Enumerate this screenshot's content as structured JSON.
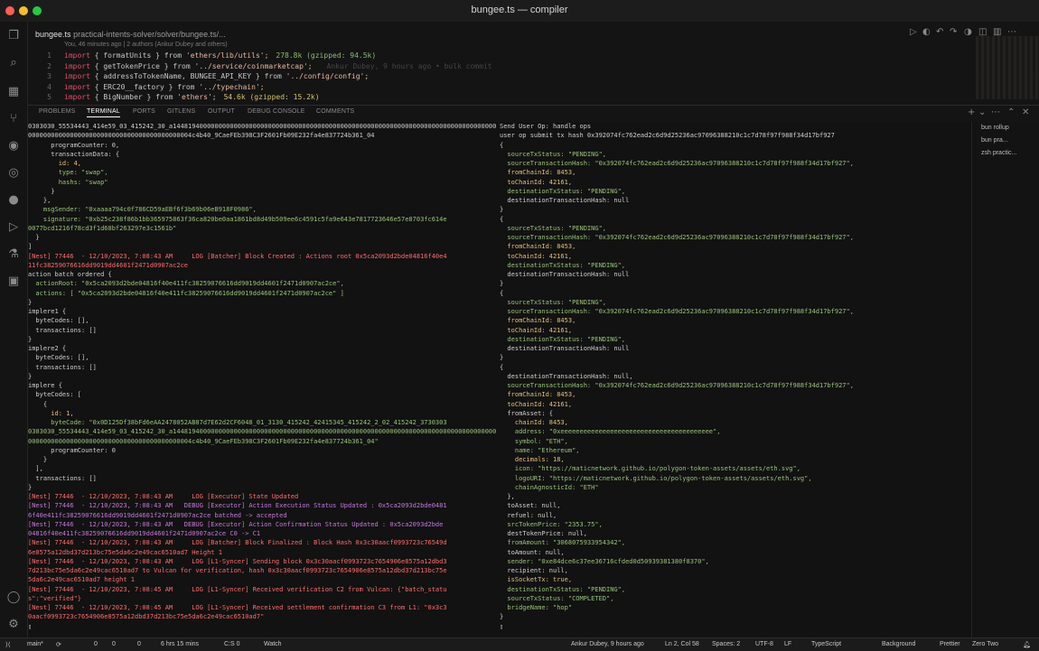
{
  "window": {
    "title": "bungee.ts — compiler",
    "dot_colors": [
      "#ff5f57",
      "#febc2e",
      "#28c840"
    ]
  },
  "editor": {
    "tab_name": "bungee.ts",
    "breadcrumb": "practical-intents-solver/solver/bungee.ts/...",
    "blame": "You, 46 minutes ago | 2 authors (Ankur Dubey and others)",
    "lines": [
      {
        "num": "1",
        "kw": "import",
        "body": " { formatUnits } from ",
        "src": "'ethers/lib/utils';",
        "size": "278.8k (gzipped: 94.5k)",
        "ghost": ""
      },
      {
        "num": "2",
        "kw": "import",
        "body": " { getTokenPrice } from ",
        "src": "'../service/coinmarketcap';",
        "size": "",
        "ghost": "Ankur Dubey, 9 hours ago • bulk commit"
      },
      {
        "num": "3",
        "kw": "import",
        "body": " { addressToTokenName, BUNGEE_API_KEY } from ",
        "src": "'../config/config';",
        "size": "",
        "ghost": ""
      },
      {
        "num": "4",
        "kw": "import",
        "body": " { ERC20__factory } from ",
        "src": "'../typechain';",
        "size": "",
        "ghost": ""
      },
      {
        "num": "5",
        "kw": "import",
        "body": " { BigNumber } from ",
        "src": "'ethers';",
        "size2": "54.6k (gzipped: 15.2k)",
        "ghost": ""
      }
    ]
  },
  "panel": {
    "tabs": [
      "PROBLEMS",
      "TERMINAL",
      "PORTS",
      "GITLENS",
      "OUTPUT",
      "DEBUG CONSOLE",
      "COMMENTS"
    ],
    "active_tab": "TERMINAL",
    "sessions": [
      "bun rollup",
      "bun pra...",
      "zsh practic..."
    ]
  },
  "terminal_left": [
    {
      "t": "0303030_55534443_414e59_03_415242_30_a1448194000000000000000000000000000000000000000000000000000000000000000000000000000000",
      "c": "g"
    },
    {
      "t": "0000000000000000000000000000000000000000004c4b40_9CaeFEb398C3F2601Fb09E232fa4e837724b361_04",
      "c": "g"
    },
    {
      "t": "      programCounter: 0,",
      "c": "g"
    },
    {
      "t": "      transactionData: {",
      "c": "g"
    },
    {
      "t": "        id: 4,",
      "c": "n"
    },
    {
      "t": "        type: \"swap\",",
      "c": "s"
    },
    {
      "t": "        hashs: \"swap\"",
      "c": "s"
    },
    {
      "t": "      }",
      "c": "g"
    },
    {
      "t": "    },",
      "c": "g"
    },
    {
      "t": "    msgSender: \"0xaaaa794c0f786CD59aEBf6f3b69b06eB918F0986\",",
      "c": "s"
    },
    {
      "t": "    signature: \"0xb25c238f86b1bb365975863f36ca820be0aa1861bd8d49b509ee6c4591c5fa9e643e7817723646e57e8703fc614e",
      "c": "s"
    },
    {
      "t": "0077bcd1216f78cd3f1d68bf263297e3c1561b\"",
      "c": "s"
    },
    {
      "t": "  }",
      "c": "g"
    },
    {
      "t": "]",
      "c": "g"
    },
    {
      "t": "[Nest] 77446  - 12/10/2023, 7:08:43 AM     LOG [Batcher] Block Created : Actions root 0x5ca2093d2bde04816f40e4",
      "c": "r"
    },
    {
      "t": "11fc38259076616dd9019dd4601f2471d0907ac2ce",
      "c": "r"
    },
    {
      "t": "action batch ordered {",
      "c": "g"
    },
    {
      "t": "  actionRoot: \"0x5ca2093d2bde04816f40e411fc38259076616dd9019dd4601f2471d0907ac2ce\",",
      "c": "s"
    },
    {
      "t": "  actions: [ \"0x5ca2093d2bde04816f40e411fc38259076616dd9019dd4601f2471d0907ac2ce\" ]",
      "c": "s"
    },
    {
      "t": "}",
      "c": "g"
    },
    {
      "t": "implere1 {",
      "c": "g"
    },
    {
      "t": "  byteCodes: [],",
      "c": "g"
    },
    {
      "t": "  transactions: []",
      "c": "g"
    },
    {
      "t": "}",
      "c": "g"
    },
    {
      "t": "implere2 {",
      "c": "g"
    },
    {
      "t": "  byteCodes: [],",
      "c": "g"
    },
    {
      "t": "  transactions: []",
      "c": "g"
    },
    {
      "t": "}",
      "c": "g"
    },
    {
      "t": "implere {",
      "c": "g"
    },
    {
      "t": "  byteCodes: [",
      "c": "g"
    },
    {
      "t": "    {",
      "c": "g"
    },
    {
      "t": "      id: 1,",
      "c": "n"
    },
    {
      "t": "      byteCode: \"0x0D125Df38bFd6eAA2478052AB87d7E62d2CF6048_01_3130_415242_42415345_415242_2_02_415242_3730303",
      "c": "s"
    },
    {
      "t": "0303030_55534443_414e59_03_415242_30_a1448194000000000000000000000000000000000000000000000000000000000000000000000000000000",
      "c": "s"
    },
    {
      "t": "0000000000000000000000000000000000000000004c4b40_9CaeFEb398C3F2601Fb09E232fa4e837724b361_04\"",
      "c": "s"
    },
    {
      "t": "      programCounter: 0",
      "c": "g"
    },
    {
      "t": "    }",
      "c": "g"
    },
    {
      "t": "  ],",
      "c": "g"
    },
    {
      "t": "  transactions: []",
      "c": "g"
    },
    {
      "t": "}",
      "c": "g"
    },
    {
      "t": "[Nest] 77446  - 12/10/2023, 7:08:43 AM     LOG [Executor] State Updated",
      "c": "r"
    },
    {
      "t": "[Nest] 77446  - 12/10/2023, 7:08:43 AM   DEBUG [Executor] Action Execution Status Updated : 0x5ca2093d2bde0481",
      "c": "v"
    },
    {
      "t": "6f40e411fc38259076616dd9019dd4601f2471d0907ac2ce batched -> accepted",
      "c": "v"
    },
    {
      "t": "[Nest] 77446  - 12/10/2023, 7:08:43 AM   DEBUG [Executor] Action Confirmation Status Updated : 0x5ca2093d2bde",
      "c": "v"
    },
    {
      "t": "04816f40e411fc38259076616dd9019dd4601f2471d0907ac2ce C0 -> C1",
      "c": "v"
    },
    {
      "t": "[Nest] 77446  - 12/10/2023, 7:08:43 AM     LOG [Batcher] Block Finalized : Block Hash 0x3c30aacf0993723c76549d",
      "c": "r"
    },
    {
      "t": "6e8575a12dbd37d213bc75e5da6c2e49cac6510ad7 Height 1",
      "c": "r"
    },
    {
      "t": "[Nest] 77446  - 12/10/2023, 7:08:43 AM     LOG [L1-Syncer] Sending block 0x3c30aacf0993723c7654906e8575a12dbd3",
      "c": "r"
    },
    {
      "t": "7d213bc75e5da6c2e49cac6510ad7 to Vulcan for verification, hash 0x3c30aacf0993723c7654906e8575a12dbd37d213bc75e",
      "c": "r"
    },
    {
      "t": "5da6c2e49cac6510ad7 height 1",
      "c": "r"
    },
    {
      "t": "[Nest] 77446  - 12/10/2023, 7:08:45 AM     LOG [L1-Syncer] Received verification C2 from Vulcan: {\"batch_statu",
      "c": "r"
    },
    {
      "t": "s\":\"verified\"}",
      "c": "r"
    },
    {
      "t": "[Nest] 77446  - 12/10/2023, 7:08:45 AM     LOG [L1-Syncer] Received settlement confirmation C3 from L1: \"0x3c3",
      "c": "r"
    },
    {
      "t": "0aacf0993723c7654906e8575a12dbd37d213bc75e5da6c2e49cac6510ad7\"",
      "c": "r"
    },
    {
      "t": "▯",
      "c": "g"
    }
  ],
  "terminal_right": [
    {
      "t": "Send User Op: handle ops",
      "c": "g"
    },
    {
      "t": "user op submit tx hash 0x392074fc762ead2c6d9d25236ac97096388210c1c7d78f97f988f34d17bf927",
      "c": "g"
    },
    {
      "t": "{",
      "c": "g"
    },
    {
      "t": "  sourceTxStatus: \"PENDING\",",
      "c": "s"
    },
    {
      "t": "  sourceTransactionHash: \"0x392074fc762ead2c6d9d25236ac97096388210c1c7d78f97f988f34d17bf927\",",
      "c": "s"
    },
    {
      "t": "  fromChainId: 8453,",
      "c": "n"
    },
    {
      "t": "  toChainId: 42161,",
      "c": "n"
    },
    {
      "t": "  destinationTxStatus: \"PENDING\",",
      "c": "s"
    },
    {
      "t": "  destinationTransactionHash: null",
      "c": "g"
    },
    {
      "t": "}",
      "c": "g"
    },
    {
      "t": "{",
      "c": "g"
    },
    {
      "t": "  sourceTxStatus: \"PENDING\",",
      "c": "s"
    },
    {
      "t": "  sourceTransactionHash: \"0x392074fc762ead2c6d9d25236ac97096388210c1c7d78f97f988f34d17bf927\",",
      "c": "s"
    },
    {
      "t": "  fromChainId: 8453,",
      "c": "n"
    },
    {
      "t": "  toChainId: 42161,",
      "c": "n"
    },
    {
      "t": "  destinationTxStatus: \"PENDING\",",
      "c": "s"
    },
    {
      "t": "  destinationTransactionHash: null",
      "c": "g"
    },
    {
      "t": "}",
      "c": "g"
    },
    {
      "t": "{",
      "c": "g"
    },
    {
      "t": "  sourceTxStatus: \"PENDING\",",
      "c": "s"
    },
    {
      "t": "  sourceTransactionHash: \"0x392074fc762ead2c6d9d25236ac97096388210c1c7d78f97f988f34d17bf927\",",
      "c": "s"
    },
    {
      "t": "  fromChainId: 8453,",
      "c": "n"
    },
    {
      "t": "  toChainId: 42161,",
      "c": "n"
    },
    {
      "t": "  destinationTxStatus: \"PENDING\",",
      "c": "s"
    },
    {
      "t": "  destinationTransactionHash: null",
      "c": "g"
    },
    {
      "t": "}",
      "c": "g"
    },
    {
      "t": "{",
      "c": "g"
    },
    {
      "t": "  destinationTransactionHash: null,",
      "c": "g"
    },
    {
      "t": "  sourceTransactionHash: \"0x392074fc762ead2c6d9d25236ac97096388210c1c7d78f97f988f34d17bf927\",",
      "c": "s"
    },
    {
      "t": "  fromChainId: 8453,",
      "c": "n"
    },
    {
      "t": "  toChainId: 42161,",
      "c": "n"
    },
    {
      "t": "  fromAsset: {",
      "c": "g"
    },
    {
      "t": "    chainId: 8453,",
      "c": "n"
    },
    {
      "t": "    address: \"0xeeeeeeeeeeeeeeeeeeeeeeeeeeeeeeeeeeeeeeee\",",
      "c": "s"
    },
    {
      "t": "    symbol: \"ETH\",",
      "c": "s"
    },
    {
      "t": "    name: \"Ethereum\",",
      "c": "s"
    },
    {
      "t": "    decimals: 18,",
      "c": "n"
    },
    {
      "t": "    icon: \"https://maticnetwork.github.io/polygon-token-assets/assets/eth.svg\",",
      "c": "s"
    },
    {
      "t": "    logoURI: \"https://maticnetwork.github.io/polygon-token-assets/assets/eth.svg\",",
      "c": "s"
    },
    {
      "t": "    chainAgnosticId: \"ETH\"",
      "c": "s"
    },
    {
      "t": "  },",
      "c": "g"
    },
    {
      "t": "  toAsset: null,",
      "c": "g"
    },
    {
      "t": "  refuel: null,",
      "c": "g"
    },
    {
      "t": "  srcTokenPrice: \"2353.75\",",
      "c": "s"
    },
    {
      "t": "  destTokenPrice: null,",
      "c": "g"
    },
    {
      "t": "  fromAmount: \"3068075933954342\",",
      "c": "s"
    },
    {
      "t": "  toAmount: null,",
      "c": "g"
    },
    {
      "t": "  sender: \"0xe84dce6c37ee36716cfded0d50939381380f8370\",",
      "c": "s"
    },
    {
      "t": "  recipient: null,",
      "c": "g"
    },
    {
      "t": "  isSocketTx: true,",
      "c": "n"
    },
    {
      "t": "  destinationTxStatus: \"PENDING\",",
      "c": "s"
    },
    {
      "t": "  sourceTxStatus: \"COMPLETED\",",
      "c": "s"
    },
    {
      "t": "  bridgeName: \"hop\"",
      "c": "s"
    },
    {
      "t": "}",
      "c": "g"
    },
    {
      "t": "▯",
      "c": "g"
    }
  ],
  "statusbar": {
    "branch": "main*",
    "errors": "0",
    "warnings": "0",
    "ports": "0",
    "time": "6 hrs 15 mins",
    "cs": "C:S 0",
    "watch": "Watch",
    "blame": "Ankur Dubey, 9 hours ago",
    "position": "Ln 2, Col 58",
    "spaces": "Spaces: 2",
    "encoding": "UTF-8",
    "eol": "LF",
    "language": "TypeScript",
    "background": "Background",
    "prettier": "Prettier",
    "theme": "Zero Two"
  }
}
